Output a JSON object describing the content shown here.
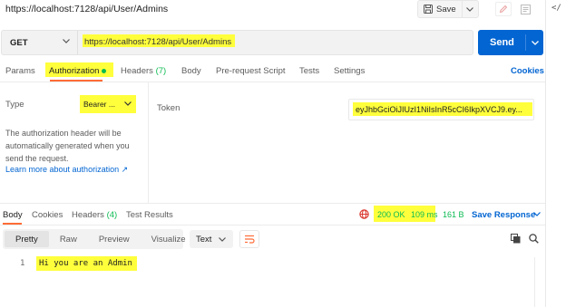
{
  "request": {
    "title": "https://localhost:7128/api/User/Admins",
    "save_label": "Save",
    "method": "GET",
    "url": "https://localhost:7128/api/User/Admins",
    "send_label": "Send",
    "code_icon": "</"
  },
  "request_tabs": {
    "params": "Params",
    "authorization": "Authorization",
    "headers": "Headers",
    "headers_count": "(7)",
    "body": "Body",
    "prerequest": "Pre-request Script",
    "tests": "Tests",
    "settings": "Settings",
    "cookies": "Cookies"
  },
  "auth": {
    "type_label": "Type",
    "type_value": "Bearer ...",
    "help_text": "The authorization header will be automatically generated when you send the request.",
    "learn_more": "Learn more about authorization ↗",
    "token_label": "Token",
    "token_value": "eyJhbGciOiJIUzI1NiIsInR5cCI6IkpXVCJ9.ey..."
  },
  "response": {
    "tabs": {
      "body": "Body",
      "cookies": "Cookies",
      "headers": "Headers",
      "headers_count": "(4)",
      "test_results": "Test Results"
    },
    "status": "200 OK",
    "time": "109 ms",
    "size": "161 B",
    "save_response": "Save Response",
    "formats": {
      "pretty": "Pretty",
      "raw": "Raw",
      "preview": "Preview",
      "visualize": "Visualize"
    },
    "language": "Text",
    "lines": [
      {
        "number": "1",
        "text": "Hi you are an Admin"
      }
    ]
  },
  "colors": {
    "accent": "#ff6c37",
    "primary": "#0265d2",
    "success": "#0cbb52",
    "highlight": "#ffff3c"
  },
  "icons": [
    "save-icon",
    "chevron-down-icon",
    "edit-icon",
    "document-icon",
    "code-icon",
    "globe-icon",
    "wrap-lines-icon",
    "copy-icon",
    "search-icon"
  ]
}
